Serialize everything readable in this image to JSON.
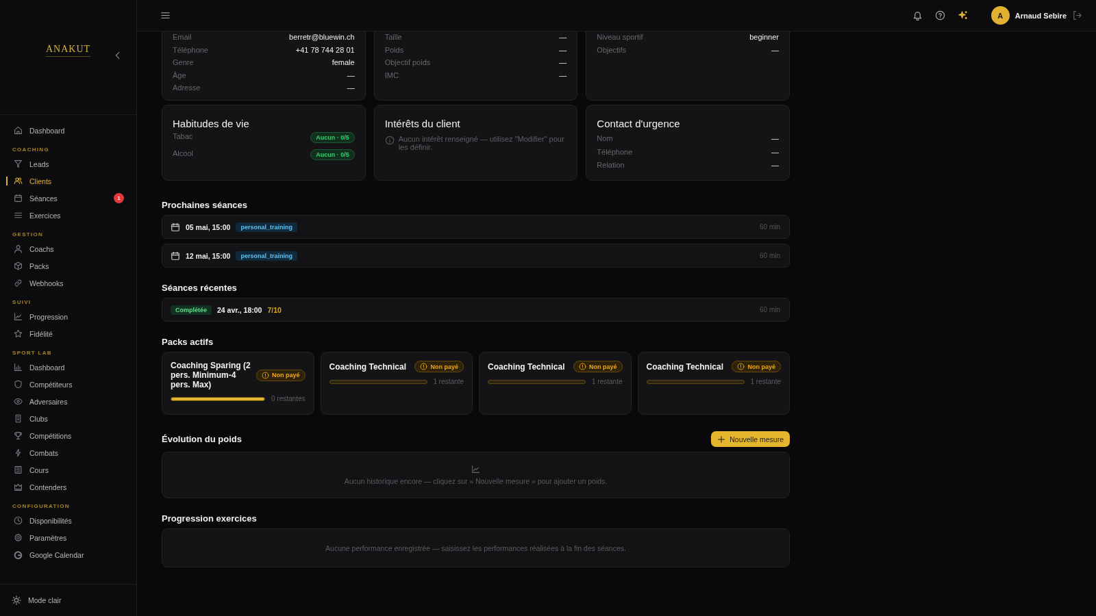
{
  "sidebar": {
    "logo": "ANAKUT",
    "groups": [
      {
        "items": [
          {
            "label": "Dashboard",
            "selected": false
          }
        ]
      },
      {
        "title": "COACHING",
        "items": [
          {
            "label": "Leads",
            "selected": false
          },
          {
            "label": "Clients",
            "selected": true
          },
          {
            "label": "Séances",
            "selected": false,
            "badge": "1"
          },
          {
            "label": "Exercices",
            "selected": false
          }
        ]
      },
      {
        "title": "GESTION",
        "items": [
          {
            "label": "Coachs",
            "selected": false
          },
          {
            "label": "Packs",
            "selected": false
          },
          {
            "label": "Webhooks",
            "selected": false
          }
        ]
      },
      {
        "title": "SUIVI",
        "items": [
          {
            "label": "Progression",
            "selected": false
          },
          {
            "label": "Fidélité",
            "selected": false
          }
        ]
      },
      {
        "title": "SPORT LAB",
        "items": [
          {
            "label": "Dashboard",
            "selected": false
          },
          {
            "label": "Compétiteurs",
            "selected": false
          },
          {
            "label": "Adversaires",
            "selected": false
          },
          {
            "label": "Clubs",
            "selected": false
          },
          {
            "label": "Compétitions",
            "selected": false
          },
          {
            "label": "Combats",
            "selected": false
          },
          {
            "label": "Cours",
            "selected": false
          },
          {
            "label": "Contenders",
            "selected": false
          }
        ]
      },
      {
        "title": "CONFIGURATION",
        "items": [
          {
            "label": "Disponibilités",
            "selected": false
          },
          {
            "label": "Paramètres",
            "selected": false
          },
          {
            "label": "Google Calendar",
            "selected": false
          }
        ]
      }
    ],
    "footer": "Mode clair"
  },
  "topbar": {
    "user": {
      "initial": "A",
      "name": "Arnaud Sebire"
    }
  },
  "info_cards": [
    {
      "rows": [
        {
          "label": "Email",
          "value": "berretr@bluewin.ch"
        },
        {
          "label": "Téléphone",
          "value": "+41 78 744 28 01"
        },
        {
          "label": "Genre",
          "value": "female"
        },
        {
          "label": "Âge",
          "value": "—"
        },
        {
          "label": "Adresse",
          "value": "—"
        }
      ]
    },
    {
      "rows": [
        {
          "label": "Taille",
          "value": "—"
        },
        {
          "label": "Poids",
          "value": "—"
        },
        {
          "label": "Objectif poids",
          "value": "—"
        },
        {
          "label": "IMC",
          "value": "—"
        }
      ]
    },
    {
      "rows": [
        {
          "label": "Niveau sportif",
          "value": "beginner"
        },
        {
          "label": "Objectifs",
          "value": "—"
        }
      ]
    }
  ],
  "detail_cards": [
    {
      "title": "Habitudes de vie",
      "kind": "badges",
      "rows": [
        {
          "label": "Tabac",
          "value": "Aucun · 0/5"
        },
        {
          "label": "Alcool",
          "value": "Aucun · 0/5"
        }
      ]
    },
    {
      "title": "Intérêts du client",
      "kind": "note",
      "note": "Aucun intérêt renseigné — utilisez \"Modifier\" pour les définir."
    },
    {
      "title": "Contact d'urgence",
      "kind": "rows",
      "rows": [
        {
          "label": "Nom",
          "value": "—"
        },
        {
          "label": "Téléphone",
          "value": "—"
        },
        {
          "label": "Relation",
          "value": "—"
        }
      ]
    }
  ],
  "upcoming": {
    "title": "Prochaines séances",
    "sessions": [
      {
        "date": "05 mai, 15:00",
        "type": "personal_training",
        "duration": "60 min"
      },
      {
        "date": "12 mai, 15:00",
        "type": "personal_training",
        "duration": "60 min"
      }
    ]
  },
  "recent": {
    "title": "Séances récentes",
    "sessions": [
      {
        "status": "Complétée",
        "date": "24 avr., 18:00",
        "score": "7/10",
        "duration": "60 min"
      }
    ]
  },
  "packs": {
    "title": "Packs actifs",
    "items": [
      {
        "name": "Coaching Sparing (2 pers. Minimum-4 pers. Max)",
        "status": "Non payé",
        "level": 1,
        "remaining": "0 restantes"
      },
      {
        "name": "Coaching Technical",
        "status": "Non payé",
        "level": 0,
        "remaining": "1 restante"
      },
      {
        "name": "Coaching Technical",
        "status": "Non payé",
        "level": 0,
        "remaining": "1 restante"
      },
      {
        "name": "Coaching Technical",
        "status": "Non payé",
        "level": 0,
        "remaining": "1 restante"
      }
    ]
  },
  "weight": {
    "title": "Évolution du poids",
    "button": "Nouvelle mesure",
    "empty": "Aucun historique encore — cliquez sur « Nouvelle mesure » pour ajouter un poids."
  },
  "exercises": {
    "title": "Progression exercices",
    "empty": "Aucune performance enregistrée — saisissez les performances réalisées à la fin des séances."
  }
}
